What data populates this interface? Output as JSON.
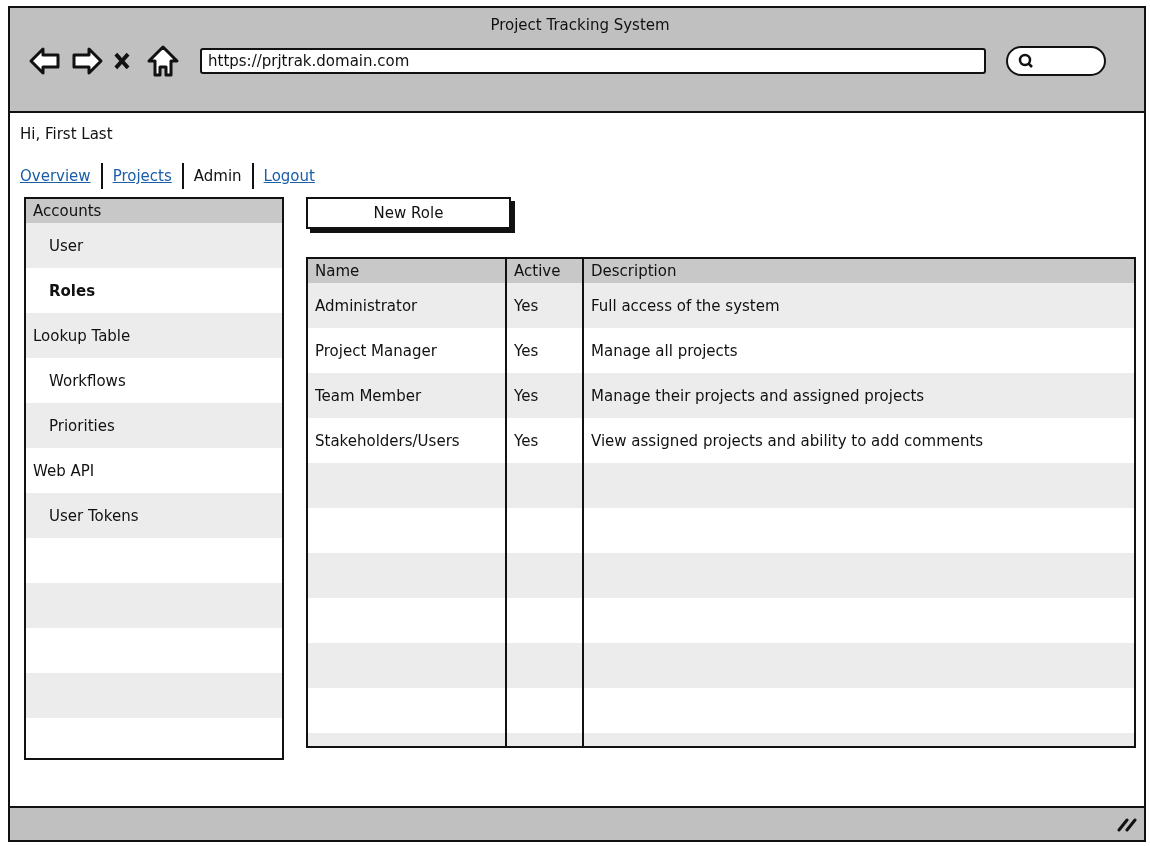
{
  "window": {
    "title": "Project Tracking System"
  },
  "address_bar": {
    "value": "https://prjtrak.domain.com"
  },
  "greeting": "Hi, First Last",
  "nav": [
    {
      "label": "Overview",
      "selected": false
    },
    {
      "label": "Projects",
      "selected": false
    },
    {
      "label": "Admin",
      "selected": true
    },
    {
      "label": "Logout",
      "selected": false
    }
  ],
  "sidebar": {
    "header": "Accounts",
    "items": [
      {
        "label": "User",
        "selected": false
      },
      {
        "label": "Roles",
        "selected": true
      },
      {
        "label": "Lookup Table",
        "selected": false,
        "children": [
          {
            "label": "Workflows",
            "selected": false
          },
          {
            "label": "Priorities",
            "selected": false
          }
        ]
      },
      {
        "label": "Web API",
        "selected": false,
        "children": [
          {
            "label": "User Tokens",
            "selected": false
          }
        ]
      }
    ]
  },
  "new_role_button": "New Role",
  "table": {
    "columns": [
      "Name",
      "Active",
      "Description"
    ],
    "rows": [
      [
        "Administrator",
        "Yes",
        "Full access of the system"
      ],
      [
        "Project Manager",
        "Yes",
        "Manage all projects"
      ],
      [
        "Team Member",
        "Yes",
        "Manage their projects and assigned projects"
      ],
      [
        "Stakeholders/Users",
        "Yes",
        "View assigned projects and ability to add comments"
      ]
    ]
  }
}
